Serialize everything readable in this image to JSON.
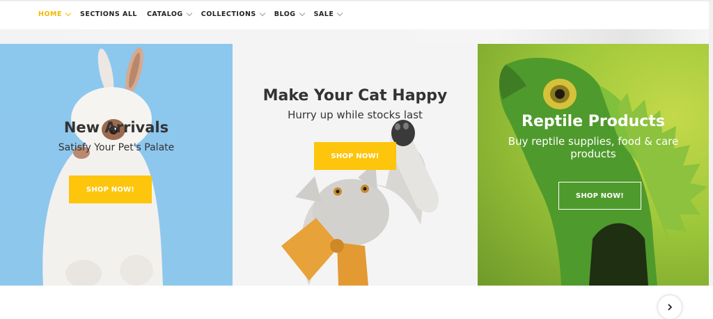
{
  "nav": {
    "items": [
      {
        "label": "HOME",
        "active": true,
        "dropdown": true
      },
      {
        "label": "SECTIONS ALL",
        "active": false,
        "dropdown": false
      },
      {
        "label": "CATALOG",
        "active": false,
        "dropdown": true
      },
      {
        "label": "COLLECTIONS",
        "active": false,
        "dropdown": true
      },
      {
        "label": "BLOG",
        "active": false,
        "dropdown": true
      },
      {
        "label": "SALE",
        "active": false,
        "dropdown": true
      }
    ]
  },
  "banners": [
    {
      "title": "New Arrivals",
      "subtitle": "Satisfy Your Pet's Palate",
      "button": "SHOP NOW!",
      "image": "white-rabbit"
    },
    {
      "title": "Make Your Cat Happy",
      "subtitle": "Hurry up while stocks last",
      "button": "SHOP NOW!",
      "image": "kitten-with-bow-tie"
    },
    {
      "title": "Reptile Products",
      "subtitle": "Buy reptile supplies, food & care products",
      "button": "SHOP NOW!",
      "image": "green-iguana"
    }
  ],
  "slider": {
    "next_icon": "chevron-right-icon"
  },
  "colors": {
    "accent": "#fdc50c",
    "nav_active": "#f5b800",
    "text": "#333333",
    "panel1_bg": "#8cc7ee",
    "panel2_bg": "#f4f4f4",
    "panel3_bg": "#9ec83a"
  }
}
